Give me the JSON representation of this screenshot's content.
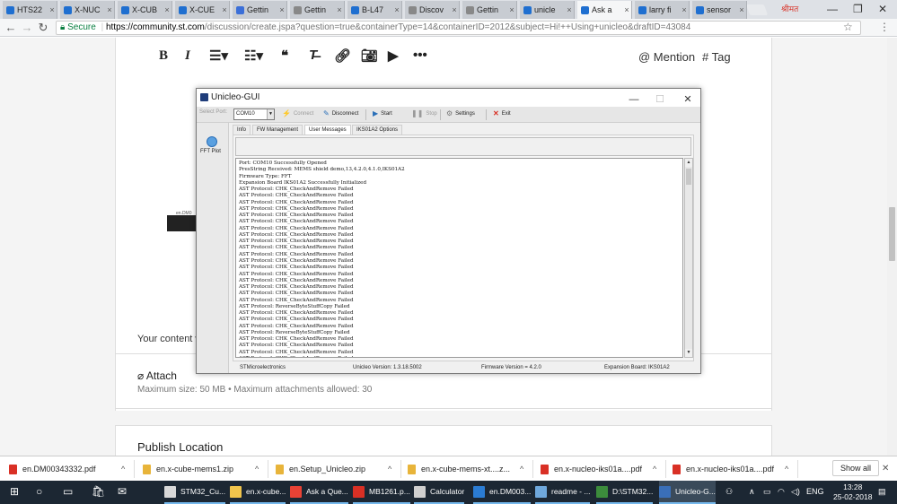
{
  "browser": {
    "tabs": [
      {
        "label": "HTS22",
        "color": "#1f6fd0"
      },
      {
        "label": "X-NUC",
        "color": "#1f6fd0"
      },
      {
        "label": "X-CUB",
        "color": "#1f6fd0"
      },
      {
        "label": "X-CUE",
        "color": "#1f6fd0"
      },
      {
        "label": "Gettin",
        "color": "#3b6fd8"
      },
      {
        "label": "Gettin",
        "color": "#888888"
      },
      {
        "label": "B-L47",
        "color": "#1f6fd0"
      },
      {
        "label": "Discov",
        "color": "#888888"
      },
      {
        "label": "Gettin",
        "color": "#888888"
      },
      {
        "label": "unicle",
        "color": "#1f6fd0"
      },
      {
        "label": "Ask a",
        "color": "#1f6fd0"
      },
      {
        "label": "larry fi",
        "color": "#1f6fd0"
      },
      {
        "label": "sensor",
        "color": "#1f6fd0"
      }
    ],
    "active_tab_index": 10,
    "user_badge": "श्रीमत",
    "url_secure": "Secure",
    "url_host": "https://community.st.com",
    "url_path": "/discussion/create.jspa?question=true&containerType=14&containerID=2012&subject=Hi!++Using+unicleo&draftID=43084"
  },
  "editor": {
    "mention": "@ Mention",
    "tag": "# Tag",
    "content_label": "Your content w",
    "attach_title": "Attach",
    "attach_sub": "Maximum size: 50 MB  •  Maximum attachments allowed: 30",
    "publish_title": "Publish Location",
    "behind_label": "en.DM0"
  },
  "unicleo": {
    "title": "Unicleo-GUI",
    "select_port_label": "Select Port:",
    "port_value": "COM10",
    "connect": "Connect",
    "disconnect": "Disconnect",
    "start": "Start",
    "stop": "Stop",
    "settings": "Settings",
    "exit": "Exit",
    "side_label": "FFT Plot",
    "tabs": [
      "Info",
      "FW Management",
      "User Messages",
      "IKS01A2 Options"
    ],
    "active_tab": 2,
    "log": [
      "Port: COM10 Successfully Opened",
      "PresString Received: MEMS shield demo,13,4.2.0,4.1.0,IKS01A2",
      "Firmware Type: FFT",
      "Expansion Board IKS01A2 Successfully Initialized",
      "AST Protocol: CHK_CheckAndRemove Failed",
      "AST Protocol: CHK_CheckAndRemove Failed",
      "AST Protocol: CHK_CheckAndRemove Failed",
      "AST Protocol: CHK_CheckAndRemove Failed",
      "AST Protocol: CHK_CheckAndRemove Failed",
      "AST Protocol: CHK_CheckAndRemove Failed",
      "AST Protocol: CHK_CheckAndRemove Failed",
      "AST Protocol: CHK_CheckAndRemove Failed",
      "AST Protocol: CHK_CheckAndRemove Failed",
      "AST Protocol: CHK_CheckAndRemove Failed",
      "AST Protocol: CHK_CheckAndRemove Failed",
      "AST Protocol: CHK_CheckAndRemove Failed",
      "AST Protocol: CHK_CheckAndRemove Failed",
      "AST Protocol: CHK_CheckAndRemove Failed",
      "AST Protocol: CHK_CheckAndRemove Failed",
      "AST Protocol: CHK_CheckAndRemove Failed",
      "AST Protocol: CHK_CheckAndRemove Failed",
      "AST Protocol: CHK_CheckAndRemove Failed",
      "AST Protocol: ReverseByteStuffCopy Failed",
      "AST Protocol: CHK_CheckAndRemove Failed",
      "AST Protocol: CHK_CheckAndRemove Failed",
      "AST Protocol: CHK_CheckAndRemove Failed",
      "AST Protocol: ReverseByteStuffCopy Failed",
      "AST Protocol: CHK_CheckAndRemove Failed",
      "AST Protocol: CHK_CheckAndRemove Failed",
      "AST Protocol: CHK_CheckAndRemove Failed",
      "AST Protocol: CHK_CheckAndRemove Failed"
    ],
    "status_company": "STMicroelectronics",
    "status_version": "Unicleo Version:  1.3.18.5002",
    "status_fw": "Firmware Version = 4.2.0",
    "status_board": "Expansion Board: IKS01A2"
  },
  "downloads": {
    "items": [
      {
        "label": "en.DM00343332.pdf",
        "color": "#d93025"
      },
      {
        "label": "en.x-cube-mems1.zip",
        "color": "#e8b43a"
      },
      {
        "label": "en.Setup_Unicleo.zip",
        "color": "#e8b43a"
      },
      {
        "label": "en.x-cube-mems-xt....z...",
        "color": "#e8b43a"
      },
      {
        "label": "en.x-nucleo-iks01a....pdf",
        "color": "#d93025"
      },
      {
        "label": "en.x-nucleo-iks01a....pdf",
        "color": "#d93025"
      }
    ],
    "show_all": "Show all"
  },
  "taskbar": {
    "apps": [
      {
        "label": "STM32_Cu...",
        "color": "#d8d8d8"
      },
      {
        "label": "en.x-cube...",
        "color": "#f0c44c"
      },
      {
        "label": "Ask a Que...",
        "color": "#e94235"
      },
      {
        "label": "MB1261.p...",
        "color": "#d93025"
      },
      {
        "label": "Calculator",
        "color": "#cfcfcf"
      },
      {
        "label": "en.DM003...",
        "color": "#2b7cd3"
      },
      {
        "label": "readme - ...",
        "color": "#6fa8dc"
      },
      {
        "label": "D:\\STM32...",
        "color": "#3c8c3c"
      },
      {
        "label": "Unicleo-G...",
        "color": "#3a6fb8"
      }
    ],
    "lang": "ENG",
    "time": "13:28",
    "date": "25-02-2018"
  }
}
